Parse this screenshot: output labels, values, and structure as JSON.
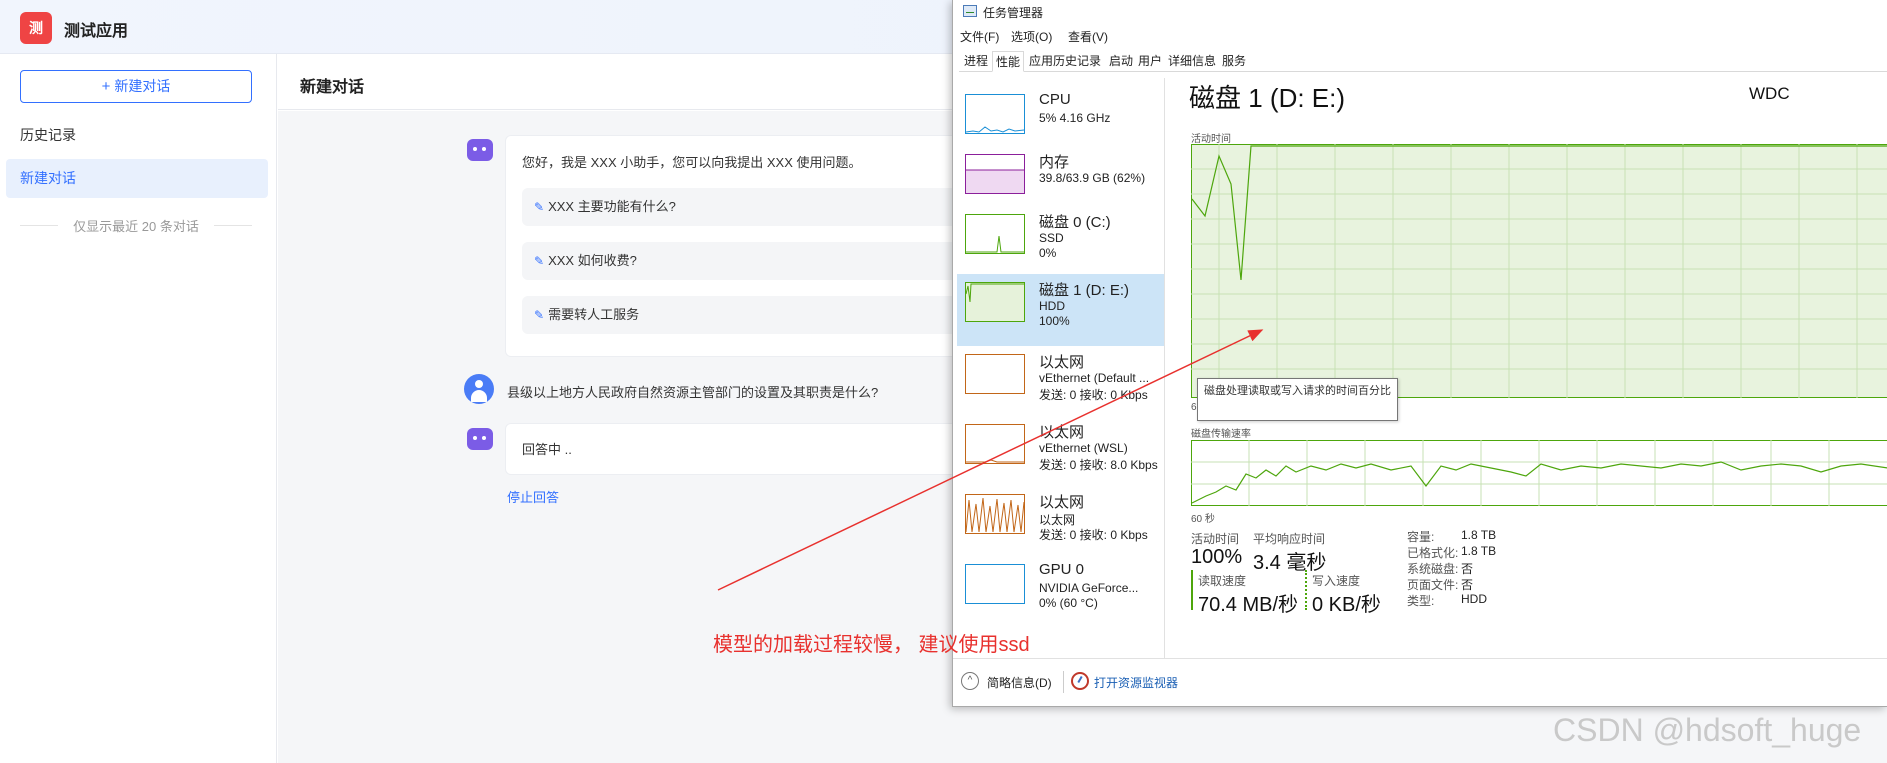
{
  "app": {
    "logo": "测",
    "name": "测试应用"
  },
  "sidebar": {
    "new_chat": "新建对话",
    "history_label": "历史记录",
    "items": [
      {
        "label": "新建对话"
      }
    ],
    "recent_note": "仅显示最近 20 条对话"
  },
  "main": {
    "title": "新建对话",
    "greeting": "您好，我是 XXX 小助手，您可以向我提出 XXX 使用问题。",
    "suggested_questions": [
      "XXX 主要功能有什么?",
      "XXX 如何收费?",
      "需要转人工服务"
    ],
    "user_message": "县级以上地方人民政府自然资源主管部门的设置及其职责是什么?",
    "answer": "回答中 ..",
    "stop": "停止回答"
  },
  "annotation": "模型的加载过程较慢， 建议使用ssd",
  "watermark": "CSDN @hdsoft_huge",
  "task_manager": {
    "title": "任务管理器",
    "menus": [
      "文件(F)",
      "选项(O)",
      "查看(V)"
    ],
    "tabs": [
      "进程",
      "性能",
      "应用历史记录",
      "启动",
      "用户",
      "详细信息",
      "服务"
    ],
    "active_tab": "性能",
    "resources": [
      {
        "name": "CPU",
        "line1": "5% 4.16 GHz",
        "line2": ""
      },
      {
        "name": "内存",
        "line1": "39.8/63.9 GB (62%)",
        "line2": ""
      },
      {
        "name": "磁盘 0 (C:)",
        "line1": "SSD",
        "line2": "0%"
      },
      {
        "name": "磁盘 1 (D: E:)",
        "line1": "HDD",
        "line2": "100%"
      },
      {
        "name": "以太网",
        "line1": "vEthernet (Default ...",
        "line2": "发送: 0 接收: 0 Kbps"
      },
      {
        "name": "以太网",
        "line1": "vEthernet (WSL)",
        "line2": "发送: 0 接收: 8.0 Kbps"
      },
      {
        "name": "以太网",
        "line1": "以太网",
        "line2": "发送: 0 接收: 0 Kbps"
      },
      {
        "name": "GPU 0",
        "line1": "NVIDIA GeForce...",
        "line2": "0% (60 °C)"
      }
    ],
    "selected_resource": "磁盘 1 (D: E:)",
    "detail": {
      "title": "磁盘 1 (D: E:)",
      "model": "WDC",
      "graph1_label": "活动时间",
      "graph1_time": "6",
      "tooltip": "磁盘处理读取或写入请求的时间百分比",
      "graph2_label": "磁盘传输速率",
      "graph2_time": "60 秒",
      "stats": {
        "active_time_label": "活动时间",
        "active_time": "100%",
        "response_label": "平均响应时间",
        "response": "3.4 毫秒",
        "read_label": "读取速度",
        "read": "70.4 MB/秒",
        "write_label": "写入速度",
        "write": "0 KB/秒"
      },
      "properties": [
        {
          "label": "容量:",
          "value": "1.8 TB"
        },
        {
          "label": "已格式化:",
          "value": "1.8 TB"
        },
        {
          "label": "系统磁盘:",
          "value": "否"
        },
        {
          "label": "页面文件:",
          "value": "否"
        },
        {
          "label": "类型:",
          "value": "HDD"
        }
      ]
    },
    "footer": {
      "brief": "简略信息(D)",
      "monitor": "打开资源监视器"
    }
  },
  "colors": {
    "accent": "#3370ff",
    "disk_green": "#4da60c",
    "annotation_red": "#e8312e"
  }
}
